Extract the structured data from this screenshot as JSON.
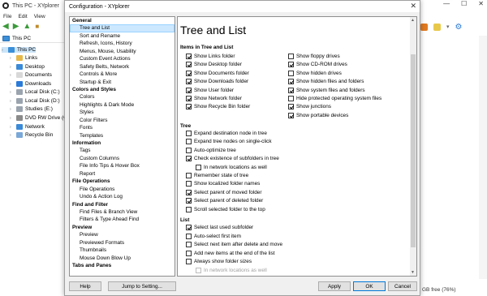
{
  "background_window": {
    "title": "This PC - XYplorer",
    "menu": [
      "File",
      "Edit",
      "View"
    ],
    "address": "This PC",
    "tree": [
      {
        "label": "This PC",
        "level": 0,
        "icon": "pc-icon",
        "selected": true
      },
      {
        "label": "Links",
        "level": 1,
        "icon": "folder-icon"
      },
      {
        "label": "Desktop",
        "level": 1,
        "icon": "desktop-icon"
      },
      {
        "label": "Documents",
        "level": 1,
        "icon": "documents-icon"
      },
      {
        "label": "Downloads",
        "level": 1,
        "icon": "downloads-icon"
      },
      {
        "label": "Local Disk (C:)",
        "level": 1,
        "icon": "drive-icon"
      },
      {
        "label": "Local Disk (D:)",
        "level": 1,
        "icon": "drive-icon"
      },
      {
        "label": "Studies (E:)",
        "level": 1,
        "icon": "drive-icon"
      },
      {
        "label": "DVD RW Drive (G:)",
        "level": 1,
        "icon": "dvd-icon"
      },
      {
        "label": "Network",
        "level": 1,
        "icon": "network-icon"
      },
      {
        "label": "Recycle Bin",
        "level": 1,
        "icon": "recycle-bin-icon"
      }
    ],
    "status_text": "GB free (76%)"
  },
  "dialog": {
    "title": "Configuration - XYplorer",
    "nav": [
      {
        "label": "General",
        "type": "cat"
      },
      {
        "label": "Tree and List",
        "type": "item",
        "active": true
      },
      {
        "label": "Sort and Rename",
        "type": "item"
      },
      {
        "label": "Refresh, Icons, History",
        "type": "item"
      },
      {
        "label": "Menus, Mouse, Usability",
        "type": "item"
      },
      {
        "label": "Custom Event Actions",
        "type": "item"
      },
      {
        "label": "Safety Belts, Network",
        "type": "item"
      },
      {
        "label": "Controls & More",
        "type": "item"
      },
      {
        "label": "Startup & Exit",
        "type": "item"
      },
      {
        "label": "Colors and Styles",
        "type": "cat"
      },
      {
        "label": "Colors",
        "type": "item"
      },
      {
        "label": "Highlights & Dark Mode",
        "type": "item"
      },
      {
        "label": "Styles",
        "type": "item"
      },
      {
        "label": "Color Filters",
        "type": "item"
      },
      {
        "label": "Fonts",
        "type": "item"
      },
      {
        "label": "Templates",
        "type": "item"
      },
      {
        "label": "Information",
        "type": "cat"
      },
      {
        "label": "Tags",
        "type": "item"
      },
      {
        "label": "Custom Columns",
        "type": "item"
      },
      {
        "label": "File Info Tips & Hover Box",
        "type": "item"
      },
      {
        "label": "Report",
        "type": "item"
      },
      {
        "label": "File Operations",
        "type": "cat"
      },
      {
        "label": "File Operations",
        "type": "item"
      },
      {
        "label": "Undo & Action Log",
        "type": "item"
      },
      {
        "label": "Find and Filter",
        "type": "cat"
      },
      {
        "label": "Find Files & Branch View",
        "type": "item"
      },
      {
        "label": "Filters & Type Ahead Find",
        "type": "item"
      },
      {
        "label": "Preview",
        "type": "cat"
      },
      {
        "label": "Preview",
        "type": "item"
      },
      {
        "label": "Previewed Formats",
        "type": "item"
      },
      {
        "label": "Thumbnails",
        "type": "item"
      },
      {
        "label": "Mouse Down Blow Up",
        "type": "item"
      },
      {
        "label": "Tabs and Panes",
        "type": "cat"
      }
    ],
    "panel": {
      "heading": "Tree and List",
      "sections": {
        "items_title": "Items in Tree and List",
        "tree_title": "Tree",
        "list_title": "List"
      },
      "items_left": [
        {
          "label": "Show Links folder",
          "checked": true
        },
        {
          "label": "Show Desktop folder",
          "checked": true
        },
        {
          "label": "Show Documents folder",
          "checked": true
        },
        {
          "label": "Show Downloads folder",
          "checked": true
        },
        {
          "label": "Show User folder",
          "checked": true
        },
        {
          "label": "Show Network folder",
          "checked": true
        },
        {
          "label": "Show Recycle Bin folder",
          "checked": true
        }
      ],
      "items_right": [
        {
          "label": "Show floppy drives",
          "checked": false
        },
        {
          "label": "Show CD-ROM drives",
          "checked": true
        },
        {
          "label": "Show hidden drives",
          "checked": false
        },
        {
          "label": "Show hidden files and folders",
          "checked": true
        },
        {
          "label": "Show system files and folders",
          "checked": true
        },
        {
          "label": "Hide protected operating system files",
          "checked": false
        },
        {
          "label": "Show junctions",
          "checked": true
        },
        {
          "label": "Show portable devices",
          "checked": true
        }
      ],
      "tree_opts": [
        {
          "label": "Expand destination node in tree",
          "checked": false
        },
        {
          "label": "Expand tree nodes on single-click",
          "checked": false
        },
        {
          "label": "Auto-optimize tree",
          "checked": false
        },
        {
          "label": "Check existence of subfolders in tree",
          "checked": true
        },
        {
          "label": "In network locations as well",
          "checked": false,
          "indent": true
        },
        {
          "label": "Remember state of tree",
          "checked": false
        },
        {
          "label": "Show localized folder names",
          "checked": false
        },
        {
          "label": "Select parent of moved folder",
          "checked": true
        },
        {
          "label": "Select parent of deleted folder",
          "checked": true
        },
        {
          "label": "Scroll selected folder to the top",
          "checked": false
        }
      ],
      "list_opts": [
        {
          "label": "Select last used subfolder",
          "checked": true
        },
        {
          "label": "Auto-select first item",
          "checked": false
        },
        {
          "label": "Select next item after delete and move",
          "checked": false
        },
        {
          "label": "Add new items at the end of the list",
          "checked": false
        },
        {
          "label": "Always show folder sizes",
          "checked": false
        },
        {
          "label": "In network locations as well",
          "checked": false,
          "indent": true,
          "disabled": true
        }
      ]
    },
    "buttons": {
      "help": "Help",
      "jump": "Jump to Setting...",
      "apply": "Apply",
      "ok": "OK",
      "cancel": "Cancel"
    }
  },
  "colors": {
    "nav_selection": "#cce8ff",
    "dialog_bg": "#f0f0f0",
    "accent_button_border": "#0078d7"
  }
}
